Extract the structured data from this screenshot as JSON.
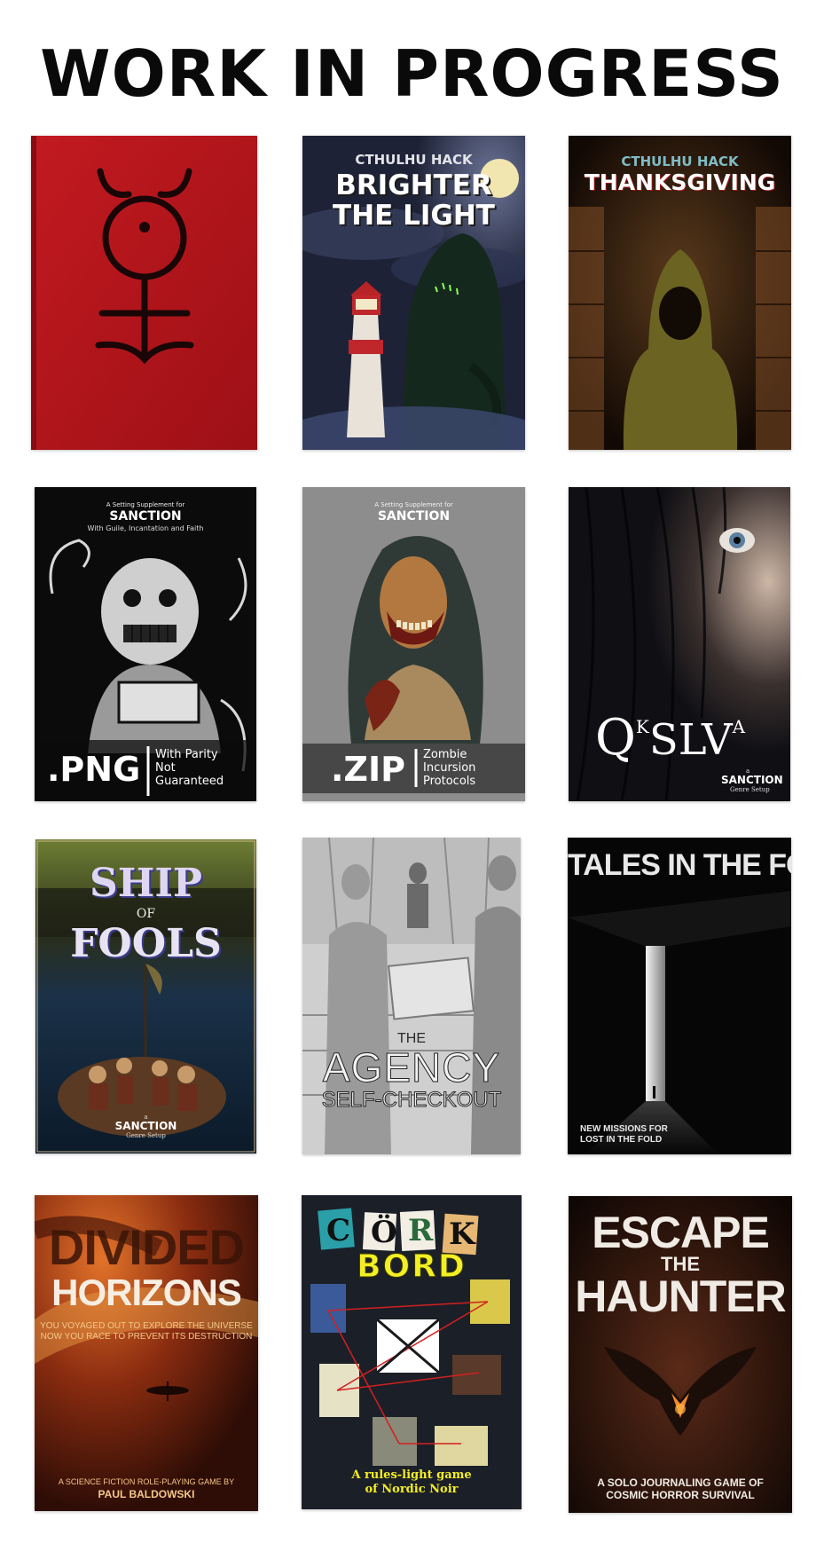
{
  "page": {
    "title": "WORK IN PROGRESS"
  },
  "covers": {
    "c1": {
      "symbol": "alchemical-symbol-icon"
    },
    "c2": {
      "kicker": "CTHULHU HACK",
      "title_line1": "BRIGHTER",
      "title_line2": "THE LIGHT"
    },
    "c3": {
      "kicker": "CTHULHU HACK",
      "title": "THANKSGIVING"
    },
    "c4": {
      "supplement": "A Setting Supplement for",
      "brand": "SANCTION",
      "tagline": "With Guile, Incantation and Faith",
      "ext": ".PNG",
      "sub1": "With Parity",
      "sub2": "Not",
      "sub3": "Guaranteed"
    },
    "c5": {
      "supplement": "A Setting Supplement for",
      "brand": "SANCTION",
      "ext": ".ZIP",
      "sub1": "Zombie",
      "sub2": "Incursion",
      "sub3": "Protocols"
    },
    "c6": {
      "title_q": "Q",
      "title_k": "K",
      "title_slv": "SLV",
      "title_a": "A",
      "small": "a",
      "brand": "SANCTION",
      "setup": "Genre Setup"
    },
    "c7": {
      "title1": "SHIP",
      "title_of": "OF",
      "title2": "FOOLS",
      "small": "a",
      "brand": "SANCTION",
      "setup": "Genre Setup"
    },
    "c8": {
      "the": "THE",
      "title": "AGENCY",
      "subtitle": "SELF-CHECKOUT"
    },
    "c9": {
      "title": "TALES IN THE FOLD",
      "tag1": "NEW MISSIONS FOR",
      "tag2": "LOST IN THE FOLD"
    },
    "c10": {
      "title1": "DIVIDED",
      "title2": "HORIZONS",
      "blurb1": "YOU VOYAGED OUT TO EXPLORE THE UNIVERSE",
      "blurb2": "NOW YOU RACE TO PREVENT ITS DESTRUCTION",
      "byline": "A SCIENCE FICTION ROLE-PLAYING GAME BY",
      "author": "PAUL BALDOWSKI"
    },
    "c11": {
      "k1": "C",
      "k2": "Ö",
      "k3": "R",
      "k4": "K",
      "title2": "BORD",
      "tag1": "A rules-light game",
      "tag2": "of Nordic Noir"
    },
    "c12": {
      "title1": "ESCAPE",
      "title_the": "THE",
      "title2": "HAUNTER",
      "tag1": "A SOLO JOURNALING GAME OF",
      "tag2": "COSMIC HORROR SURVIVAL"
    }
  },
  "colors": {
    "title": "#0a0a0a",
    "red_book": "#b2151b",
    "lighthouse_red": "#c0272d"
  }
}
